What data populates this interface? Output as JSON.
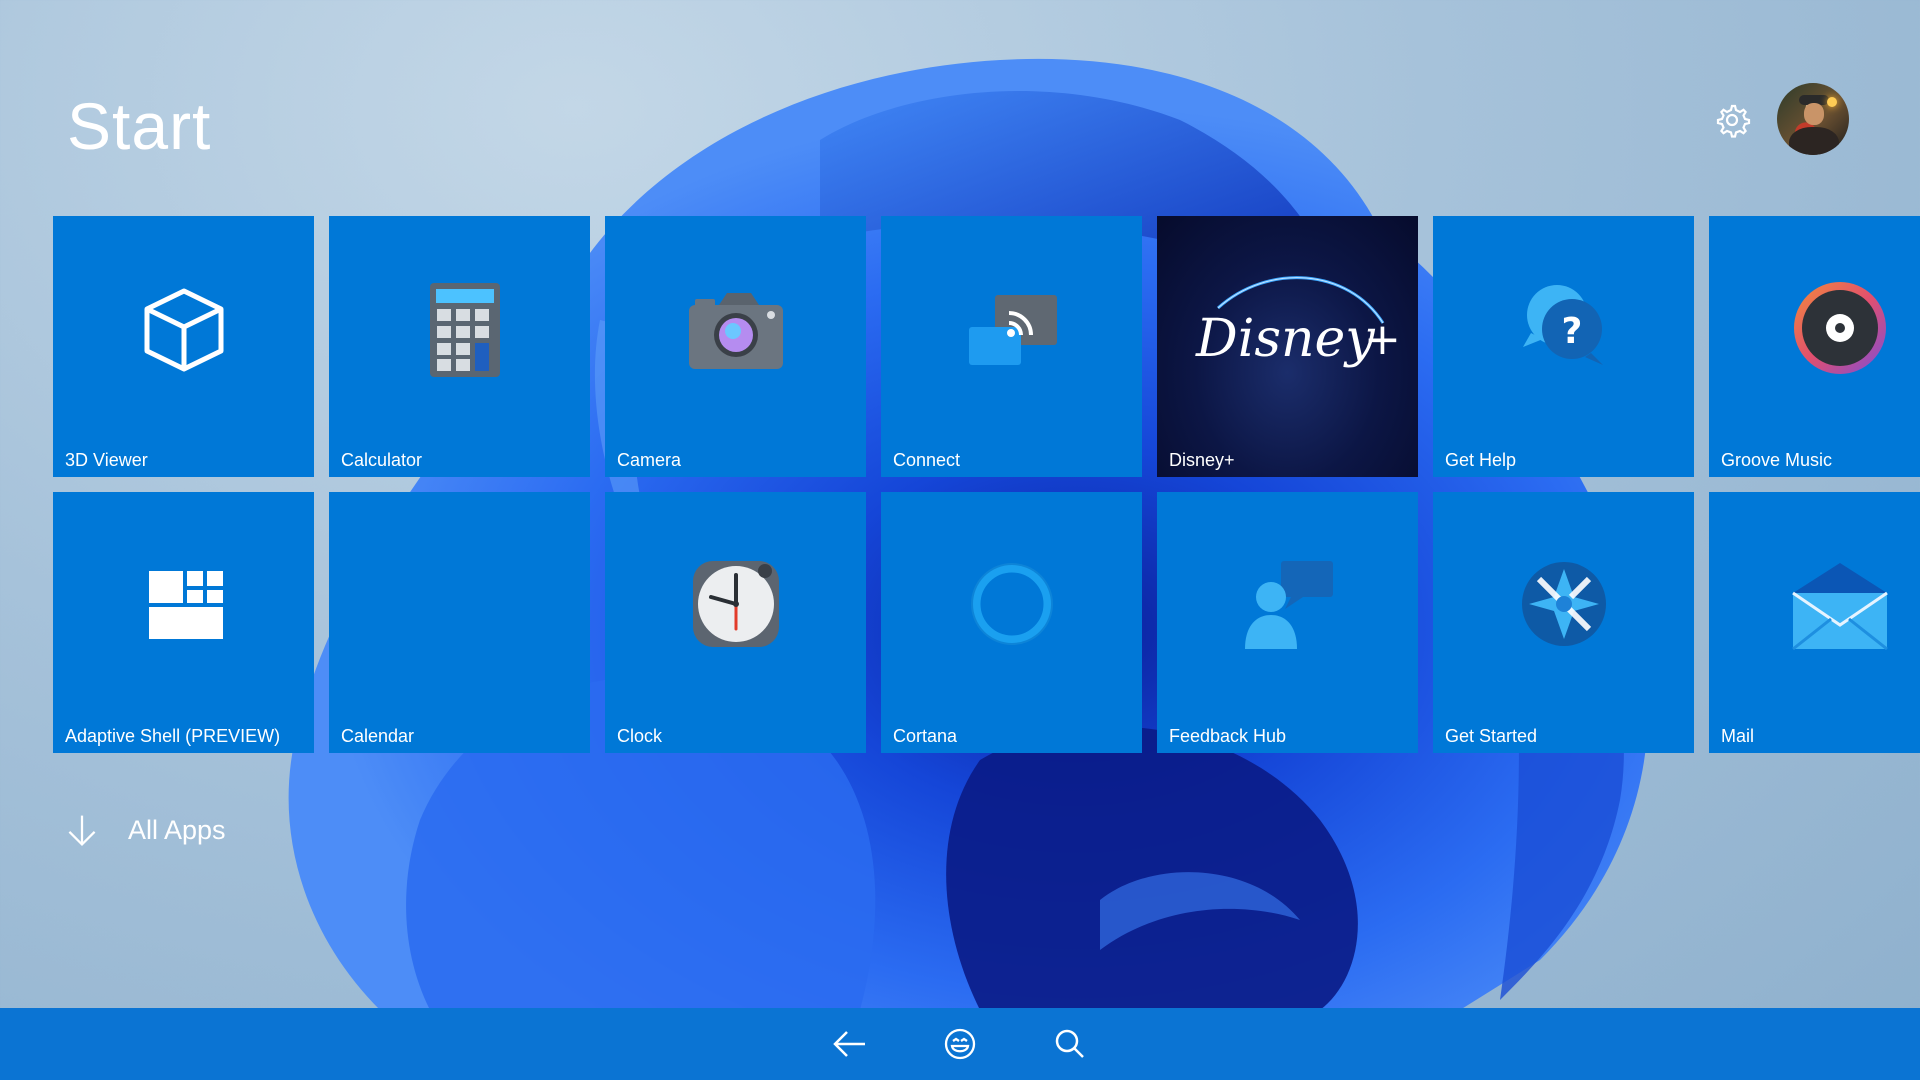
{
  "header": {
    "title": "Start"
  },
  "colors": {
    "tile": "#0078d7",
    "taskbar": "#0b74d3",
    "disney_tile": "#0c1645"
  },
  "tiles": [
    {
      "label": "3D Viewer",
      "icon": "cube-icon"
    },
    {
      "label": "Calculator",
      "icon": "calculator-icon"
    },
    {
      "label": "Camera",
      "icon": "camera-icon"
    },
    {
      "label": "Connect",
      "icon": "connect-icon"
    },
    {
      "label": "Disney+",
      "icon": "disney-plus-logo"
    },
    {
      "label": "Get Help",
      "icon": "help-icon"
    },
    {
      "label": "Groove Music",
      "icon": "groove-music-icon"
    },
    {
      "label": "Adaptive Shell (PREVIEW)",
      "icon": "grid-icon"
    },
    {
      "label": "Calendar",
      "icon": "none"
    },
    {
      "label": "Clock",
      "icon": "clock-icon"
    },
    {
      "label": "Cortana",
      "icon": "cortana-icon"
    },
    {
      "label": "Feedback Hub",
      "icon": "feedback-icon"
    },
    {
      "label": "Get Started",
      "icon": "get-started-icon"
    },
    {
      "label": "Mail",
      "icon": "mail-icon"
    }
  ],
  "all_apps": {
    "label": "All Apps",
    "icon": "arrow-down-icon"
  },
  "taskbar": {
    "icons": [
      "back-arrow-icon",
      "emoji-icon",
      "search-icon"
    ]
  },
  "settings": {
    "icon": "gear-icon"
  },
  "user": {
    "icon": "avatar"
  }
}
